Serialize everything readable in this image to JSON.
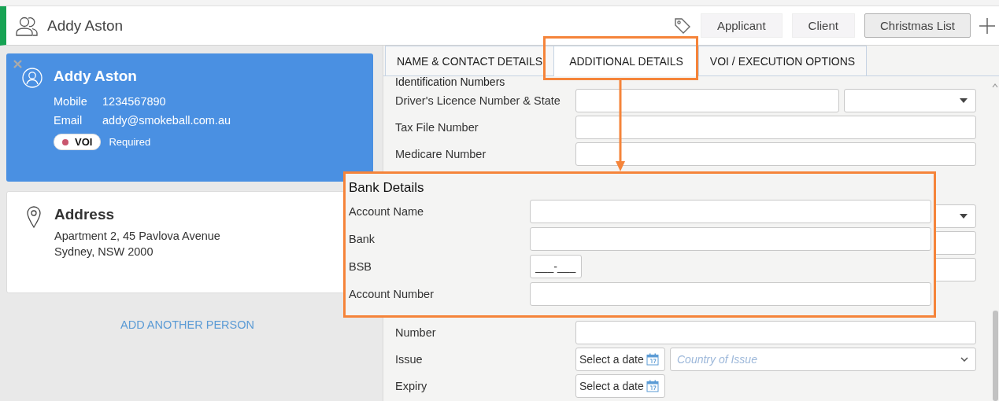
{
  "header": {
    "title": "Addy Aston",
    "tags": [
      {
        "label": "Applicant",
        "selected": false
      },
      {
        "label": "Client",
        "selected": false
      },
      {
        "label": "Christmas List",
        "selected": true
      }
    ]
  },
  "person_card": {
    "name": "Addy Aston",
    "selected": true,
    "fields": [
      {
        "label": "Mobile",
        "value": "1234567890"
      },
      {
        "label": "Email",
        "value": "addy@smokeball.com.au"
      }
    ],
    "badge": {
      "label": "VOI",
      "color": "#c9566e"
    },
    "badge_status": "Required"
  },
  "address_card": {
    "title": "Address",
    "lines": [
      "Apartment 2, 45 Pavlova Avenue",
      "Sydney, NSW 2000"
    ]
  },
  "add_link": "ADD ANOTHER PERSON",
  "tabs": [
    {
      "label": "NAME & CONTACT DETAILS",
      "selected": false
    },
    {
      "label": "ADDITIONAL DETAILS",
      "selected": true
    },
    {
      "label": "VOI / EXECUTION OPTIONS",
      "selected": false
    }
  ],
  "form": {
    "sections": [
      {
        "title": "Identification Numbers",
        "rows": [
          {
            "label": "Driver's Licence Number & State",
            "kind": "text-select"
          },
          {
            "label": "Tax File Number",
            "kind": "text"
          },
          {
            "label": "Medicare Number",
            "kind": "text"
          }
        ]
      },
      {
        "rows": [
          {
            "kind": "text-select"
          },
          {
            "kind": "text"
          },
          {
            "kind": "text"
          }
        ]
      },
      {
        "rows": [
          {
            "label": "Number",
            "kind": "text"
          },
          {
            "label": "Issue",
            "kind": "date-select",
            "value": "Select a date",
            "placeholder": "Country of Issue"
          },
          {
            "label": "Expiry",
            "kind": "date",
            "value": "Select a date"
          }
        ]
      }
    ]
  },
  "callout": {
    "title": "Bank Details",
    "rows": [
      {
        "label": "Account Name",
        "kind": "text"
      },
      {
        "label": "Bank",
        "kind": "text"
      },
      {
        "label": "BSB",
        "kind": "masked",
        "value": "___-___"
      },
      {
        "label": "Account Number",
        "kind": "text"
      }
    ]
  }
}
